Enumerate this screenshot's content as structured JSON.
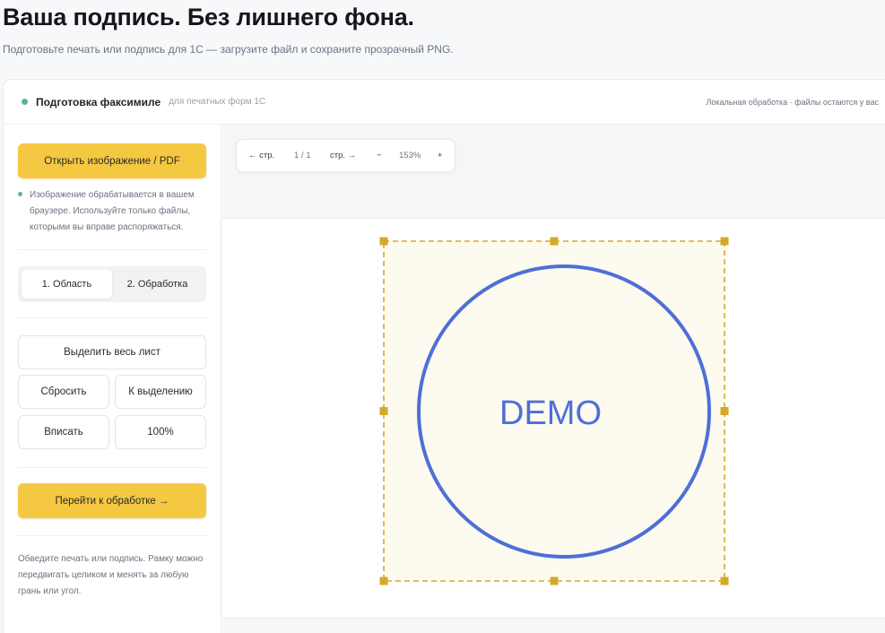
{
  "page": {
    "title": "Ваша подпись. Без лишнего фона.",
    "subtitle": "Подготовьте печать или подпись для 1С — загрузите файл и сохраните прозрачный PNG."
  },
  "header": {
    "title": "Подготовка факсимиле",
    "subtitle": "для печатных форм 1С",
    "right_note": "Локальная обработка · файлы остаются у вас"
  },
  "sidebar": {
    "open_button": "Открыть изображение / PDF",
    "privacy_note": "Изображение обрабатывается в вашем браузере. Используйте только файлы, которыми вы вправе распоряжаться.",
    "tabs": [
      {
        "label": "1. Область",
        "active": true
      },
      {
        "label": "2. Обработка",
        "active": false
      }
    ],
    "select_all_button": "Выделить весь лист",
    "reset_button": "Сбросить",
    "to_selection_button": "К выделению",
    "fit_button": "Вписать",
    "zoom_100_button": "100%",
    "next_button": "Перейти к обработке →",
    "help_text": "Обведите печать или подпись. Рамку можно передвигать целиком и менять за любую грань или угол."
  },
  "toolbar": {
    "prev_page": "← стр.",
    "page_indicator": "1 / 1",
    "next_page": "стр. →",
    "zoom_out": "−",
    "zoom_level": "153%",
    "zoom_in": "+"
  },
  "canvas": {
    "stamp_text": "DEMO",
    "stamp_color": "#4e6fd8",
    "selection_color": "#d4a92a",
    "selection_fill": "#fdfbef"
  },
  "colors": {
    "accent_yellow": "#f5c842",
    "status_green": "#5bb58a"
  }
}
